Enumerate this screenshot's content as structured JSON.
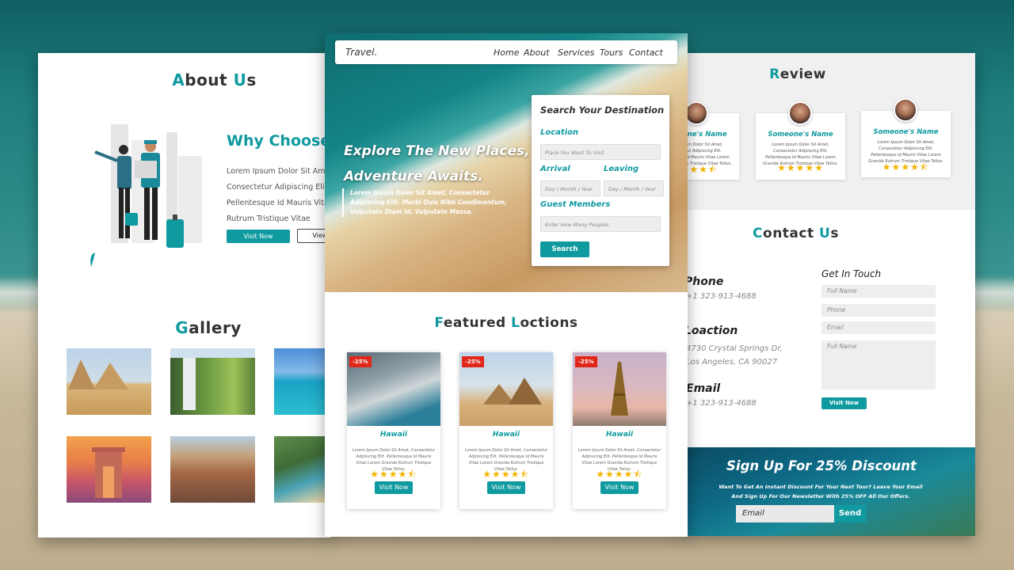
{
  "colors": {
    "accent": "#0f9aa0",
    "star": "#f4b400",
    "discount": "#e0271a"
  },
  "about": {
    "title_first": "A",
    "title_rest": "bout ",
    "title_first2": "U",
    "title_rest2": "s",
    "why_title": "Why Choose Us",
    "why_text": "Lorem Ipsum Dolor Sit Amet, Consectetur Adipiscing Elit. Pellentesque Id Mauris Vitae Gravida Rutrum Tristique Vitae",
    "visit_now": "Visit Now",
    "view_more": "View More"
  },
  "gallery": {
    "title_first": "G",
    "title_rest": "allery"
  },
  "nav": {
    "logo": "Travel.",
    "links": [
      "Home",
      "About",
      "Services",
      "Tours",
      "Contact"
    ]
  },
  "hero": {
    "title": "Explore The New Places, Adventure Awaits.",
    "text": "Lorem Ipsum Dolor Sit Amet, Consectetur Adipiscing Elit. Morbi Quis Nibh Condimentum, Vulputate Diam Id, Vulputate Massa."
  },
  "search": {
    "title": "Search Your Destination",
    "location_label": "Location",
    "location_placeholder": "Place You Want To Visit",
    "arrival_label": "Arrival",
    "leaving_label": "Leaving",
    "date_placeholder": "Day / Month / Year",
    "guest_label": "Guest Members",
    "guest_placeholder": "Enter How Many Peoples",
    "button": "Search"
  },
  "featured": {
    "title_first": "F",
    "title_rest": "eatured ",
    "title_first2": "L",
    "title_rest2": "octions",
    "cards": [
      {
        "discount": "-25%",
        "name": "Hawaii",
        "desc": "Lorem Ipsum Dolor Sit Amet, Consectetur Adipiscing Elit. Pellentesque Id Mauris Vitae Lorem Gravida Rutrum Tristique Vitae Tellus.",
        "stars": "★★★★⯪",
        "button": "Visit Now"
      },
      {
        "discount": "-25%",
        "name": "Hawaii",
        "desc": "Lorem Ipsum Dolor Sit Amet, Consectetur Adipiscing Elit. Pellentesque Id Mauris Vitae Lorem Gravida Rutrum Tristique Vitae Tellus.",
        "stars": "★★★★⯪",
        "button": "Visit Now"
      },
      {
        "discount": "-25%",
        "name": "Hawaii",
        "desc": "Lorem Ipsum Dolor Sit Amet, Consectetur Adipiscing Elit. Pellentesque Id Mauris Vitae Lorem Gravida Rutrum Tristique Vitae Tellus.",
        "stars": "★★★★⯪",
        "button": "Visit Now"
      }
    ]
  },
  "review": {
    "title_first": "R",
    "title_rest": "eview",
    "cards": [
      {
        "name": "Someone's Name",
        "text": "Lorem Ipsum Dolor Sit Amet, Consectetur Adipiscing Elit. Pellentesque Id Mauris Vitae Lorem Gravida Rutrum Tristique Vitae Tellus.",
        "stars": "★★★★⯪"
      },
      {
        "name": "Someone's Name",
        "text": "Lorem Ipsum Dolor Sit Amet, Consectetur Adipiscing Elit. Pellentesque Id Mauris Vitae Lorem Gravida Rutrum Tristique Vitae Tellus.",
        "stars": "★★★★★"
      },
      {
        "name": "Someone's Name",
        "text": "Lorem Ipsum Dolor Sit Amet, Consectetur Adipiscing Elit. Pellentesque Id Mauris Vitae Lorem Gravida Rutrum Tristique Vitae Tellus.",
        "stars": "★★★★⯪"
      }
    ]
  },
  "contact": {
    "title_first": "C",
    "title_rest": "ontact ",
    "title_first2": "U",
    "title_rest2": "s",
    "phone_label": "Phone",
    "phone_value": "+1 323-913-4688",
    "location_label": "Loaction",
    "location_line1": "4730 Crystal Springs Dr,",
    "location_line2": "Los Angeles, CA 90027",
    "email_label": "Email",
    "email_value": "+1 323-913-4688",
    "get_in_touch": "Get In Touch",
    "fullname_ph": "Full Name",
    "phone_ph": "Phone",
    "email_ph": "Email",
    "message_ph": "Full Name",
    "button": "Visit Now"
  },
  "signup": {
    "title": "Sign Up For 25% Discount",
    "text_line1": "Want To Get An Instant Discount For Your Next Tour? Leave Your Email",
    "text_line2": "And Sign Up For Our Newsletter With 25% OFF All Our Offers.",
    "email_placeholder": "Email",
    "button": "Send"
  }
}
